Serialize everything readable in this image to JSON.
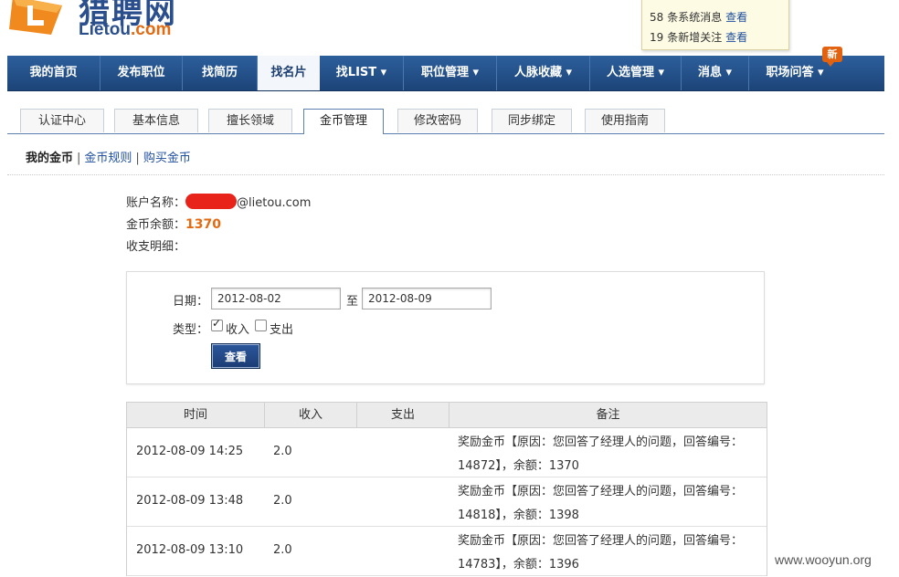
{
  "logo": {
    "cn": "猎聘网",
    "en_main": "Lietou",
    "en_suffix": ".com"
  },
  "notifications": [
    {
      "count": "58",
      "text": "条系统消息",
      "link": "查看"
    },
    {
      "count": "19",
      "text": "条新增关注",
      "link": "查看"
    }
  ],
  "nav": {
    "items": [
      "我的首页",
      "发布职位",
      "找简历",
      "找名片",
      "找LIST ▾",
      "职位管理 ▾",
      "人脉收藏 ▾",
      "人选管理 ▾",
      "消息 ▾",
      "职场问答 ▾"
    ],
    "active_index": 3,
    "new_badge": "新"
  },
  "subtabs": {
    "items": [
      "认证中心",
      "基本信息",
      "擅长领域",
      "金币管理",
      "修改密码",
      "同步绑定",
      "使用指南"
    ],
    "active_index": 3
  },
  "sublinks": {
    "current": "我的金币",
    "rules": "金币规则",
    "buy": "购买金币",
    "sep": "|"
  },
  "account": {
    "name_label": "账户名称：",
    "email_suffix": "@lietou.com",
    "balance_label": "金币余额：",
    "balance": "1370",
    "detail_label": "收支明细："
  },
  "filter": {
    "date_label": "日期：",
    "from": "2012-08-02",
    "to_label": "至",
    "to": "2012-08-09",
    "type_label": "类型：",
    "income_label": "收入",
    "income_checked": true,
    "expense_label": "支出",
    "expense_checked": false,
    "button": "查看"
  },
  "table": {
    "headers": [
      "时间",
      "收入",
      "支出",
      "备注"
    ],
    "rows": [
      {
        "time": "2012-08-09 14:25",
        "income": "2.0",
        "expense": "",
        "note_line1": "奖励金币【原因：您回答了经理人的问题，回答编号：",
        "note_line2": "14872】，余额：1370"
      },
      {
        "time": "2012-08-09 13:48",
        "income": "2.0",
        "expense": "",
        "note_line1": "奖励金币【原因：您回答了经理人的问题，回答编号：",
        "note_line2": "14818】，余额：1398"
      },
      {
        "time": "2012-08-09 13:10",
        "income": "2.0",
        "expense": "",
        "note_line1": "奖励金币【原因：您回答了经理人的问题，回答编号：",
        "note_line2": "14783】，余额：1396"
      }
    ]
  },
  "watermark": "www.wooyun.org",
  "colors": {
    "nav_blue": "#1c4478",
    "accent_orange": "#e26a12",
    "link_blue": "#1f4f9e",
    "redaction_red": "#e8231a"
  }
}
